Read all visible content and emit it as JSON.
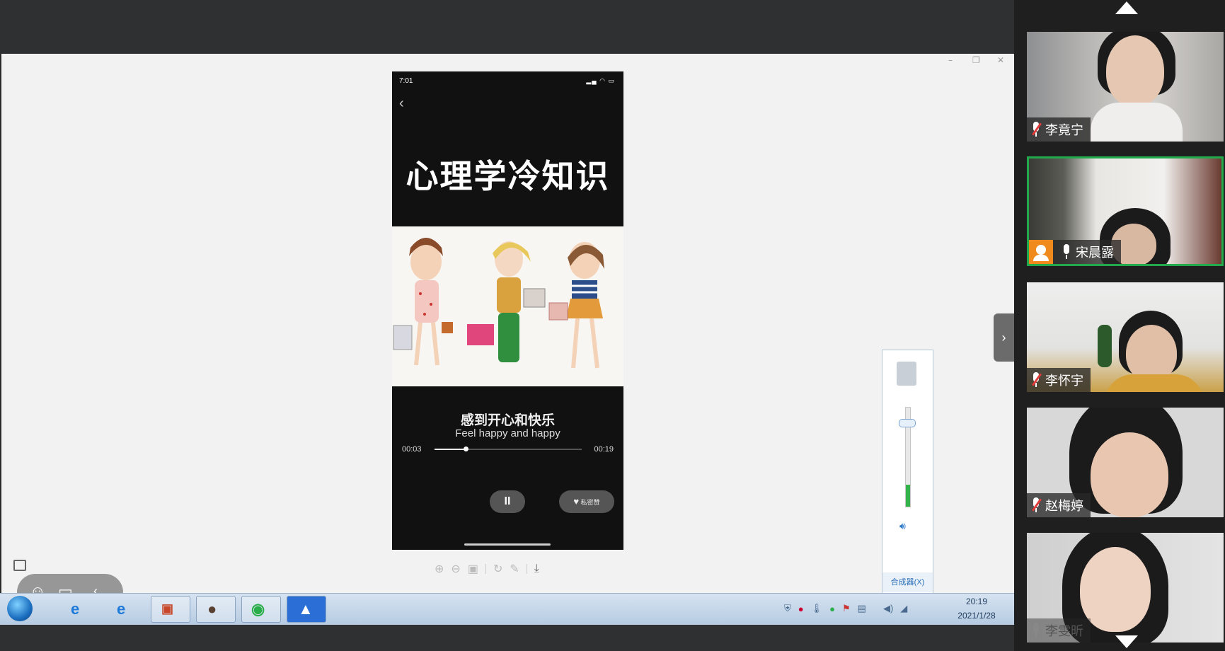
{
  "phone": {
    "status_time": "7:01",
    "headline": "心理学冷知识",
    "caption_cn": "感到开心和快乐",
    "caption_en": "Feel happy and happy",
    "time_current": "00:03",
    "time_total": "00:19",
    "progress_fraction": 0.21,
    "pause_glyph": "II",
    "like_label": "私密赞"
  },
  "volume_mixer": {
    "mixer_label": "合成器(X)",
    "level_fraction": 0.22
  },
  "taskbar": {
    "clock_time": "20:19",
    "clock_date": "2021/1/28"
  },
  "participants": [
    {
      "name": "李竟宁",
      "muted": true
    },
    {
      "name": "宋晨露",
      "muted": false,
      "host": true,
      "speaking": true
    },
    {
      "name": "李怀宇",
      "muted": true
    },
    {
      "name": "赵梅婷",
      "muted": true
    },
    {
      "name": "李雯昕",
      "muted": false
    }
  ],
  "colors": {
    "active_border": "#21a94c",
    "host_badge": "#f08a1c",
    "mute_slash": "#e23b3b"
  }
}
